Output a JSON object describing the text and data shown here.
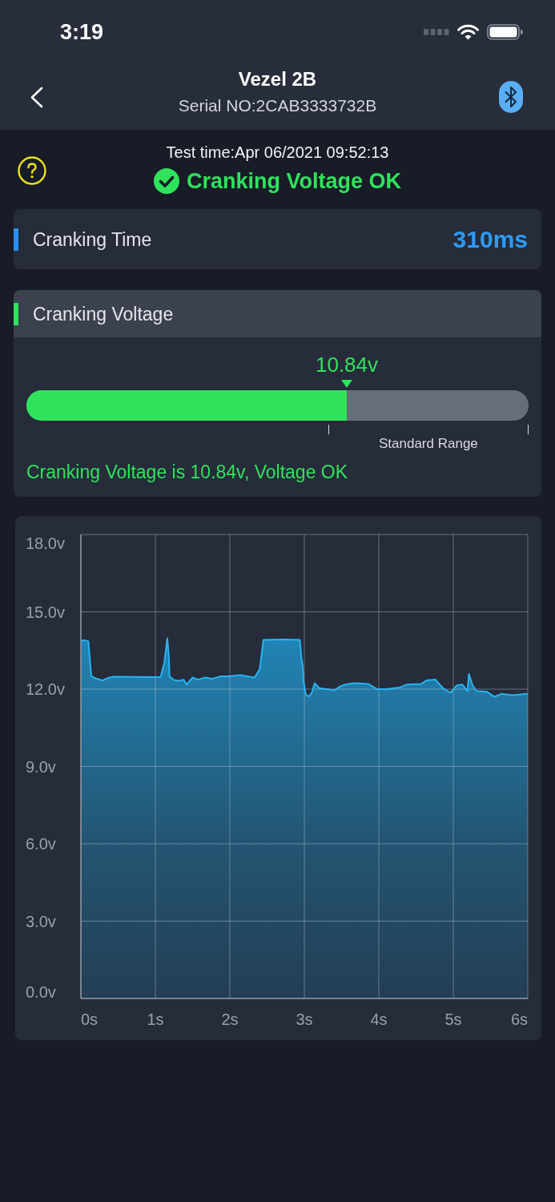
{
  "status_bar": {
    "time": "3:19"
  },
  "header": {
    "title": "Vezel 2B",
    "subtitle": "Serial NO:2CAB3333732B"
  },
  "summary": {
    "test_time": "Test time:Apr 06/2021 09:52:13",
    "result": "Cranking Voltage OK"
  },
  "cranking_time": {
    "label": "Cranking Time",
    "value": "310ms"
  },
  "cranking_voltage": {
    "label": "Cranking Voltage",
    "reading": "10.84v",
    "level": 0.638,
    "range_label": "Standard Range",
    "message": "Cranking Voltage is 10.84v, Voltage OK"
  },
  "chart": {
    "chart_data": {
      "type": "area",
      "grid": true,
      "xlim": [
        0,
        6
      ],
      "ylim": [
        0,
        18
      ],
      "xticks": [
        {
          "value": 0,
          "label": "0s"
        },
        {
          "value": 1,
          "label": "1s"
        },
        {
          "value": 2,
          "label": "2s"
        },
        {
          "value": 3,
          "label": "3s"
        },
        {
          "value": 4,
          "label": "4s"
        },
        {
          "value": 5,
          "label": "5s"
        },
        {
          "value": 6,
          "label": "6s"
        }
      ],
      "yticks": [
        {
          "value": 0,
          "label": "0.0v"
        },
        {
          "value": 3,
          "label": "3.0v"
        },
        {
          "value": 6,
          "label": "6.0v"
        },
        {
          "value": 9,
          "label": "9.0v"
        },
        {
          "value": 12,
          "label": "12.0v"
        },
        {
          "value": 15,
          "label": "15.0v"
        },
        {
          "value": 18,
          "label": "18.0v"
        }
      ],
      "x": [
        0,
        0.04,
        0.1,
        0.14,
        0.21,
        0.29,
        0.38,
        0.45,
        1.07,
        1.12,
        1.16,
        1.18,
        1.19,
        1.24,
        1.31,
        1.38,
        1.42,
        1.5,
        1.57,
        1.67,
        1.76,
        1.88,
        1.98,
        2.14,
        2.33,
        2.4,
        2.45,
        2.71,
        2.94,
        2.96,
        2.98,
        2.99,
        3.02,
        3.06,
        3.1,
        3.14,
        3.2,
        3.4,
        3.48,
        3.55,
        3.67,
        3.86,
        3.98,
        4.1,
        4.29,
        4.38,
        4.57,
        4.64,
        4.76,
        4.86,
        4.96,
        5.05,
        5.12,
        5.19,
        5.21,
        5.26,
        5.31,
        5.45,
        5.55,
        5.63,
        5.64,
        5.79,
        6
      ],
      "series": [
        {
          "color": "#27b4f2",
          "values": [
            13.88,
            13.9,
            13.86,
            12.5,
            12.41,
            12.34,
            12.45,
            12.48,
            12.47,
            13.03,
            13.97,
            13.33,
            12.5,
            12.37,
            12.32,
            12.37,
            12.18,
            12.45,
            12.37,
            12.45,
            12.4,
            12.5,
            12.5,
            12.54,
            12.45,
            12.76,
            13.91,
            13.93,
            13.91,
            13.24,
            12.87,
            12.28,
            11.79,
            11.72,
            11.86,
            12.23,
            12.04,
            11.96,
            12.1,
            12.18,
            12.23,
            12.2,
            12,
            12,
            12.07,
            12.18,
            12.2,
            12.34,
            12.37,
            12.04,
            11.86,
            12.15,
            12.18,
            11.93,
            12.59,
            12.14,
            11.93,
            11.9,
            11.71,
            11.79,
            11.82,
            11.77,
            11.82
          ]
        }
      ]
    }
  }
}
